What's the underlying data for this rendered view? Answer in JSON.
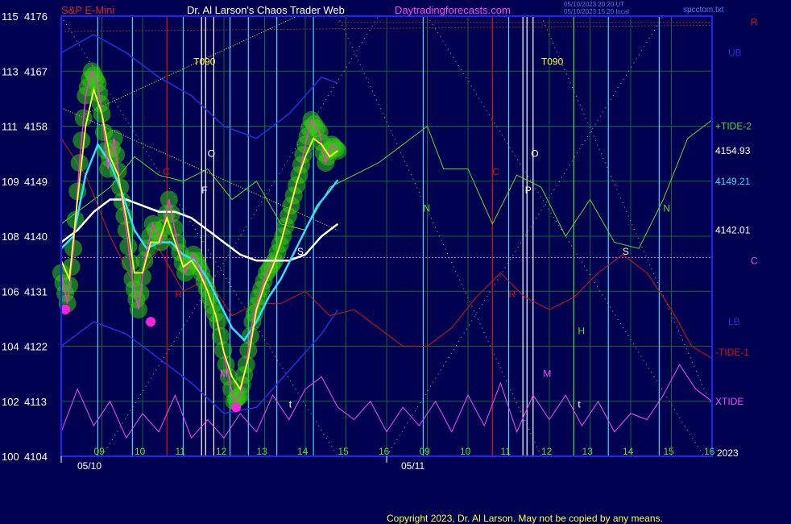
{
  "header": {
    "instrument": "S&P E-Mini",
    "site": "Dr. Al Larson's Chaos Trader Web",
    "url": "Daytradingforecasts.com",
    "timestamp_ut": "05/10/2023 20:20 UT",
    "timestamp_local": "05/10/2023 15:20 local",
    "file": "spcctom.txt"
  },
  "footer": {
    "copyright": "Copyright 2023, Dr. Al Larson. May not be copied by any means."
  },
  "colors": {
    "background": "#000050",
    "axis": "#2222ff",
    "grid": "#0a6a3a",
    "price": "#ff33cc",
    "yellow_ma": "#ffff33",
    "cyan_ma": "#33ddff",
    "white_ma": "#ffffff",
    "tide_plus": "#55dd33",
    "tide_minus": "#dd1111",
    "xtide": "#ff44ff",
    "bands": "#2233dd",
    "green_glow": "#33cc11",
    "dates": "#6666ff"
  },
  "chart_data": {
    "type": "line",
    "title": "S&P E-Mini",
    "ylim": [
      4104,
      4176
    ],
    "y_ticks": [
      {
        "left": "100",
        "price": "4104"
      },
      {
        "left": "102",
        "price": "4113"
      },
      {
        "left": "104",
        "price": "4122"
      },
      {
        "left": "106",
        "price": "4131"
      },
      {
        "left": "108",
        "price": "4140"
      },
      {
        "left": "109",
        "price": "4149"
      },
      {
        "left": "111",
        "price": "4158"
      },
      {
        "left": "113",
        "price": "4167"
      },
      {
        "left": "115",
        "price": "4176"
      }
    ],
    "x_hours": [
      "09",
      "10",
      "11",
      "12",
      "13",
      "14",
      "15",
      "16",
      "09",
      "10",
      "11",
      "12",
      "13",
      "14",
      "15",
      "16"
    ],
    "x_dates": [
      "05/10",
      "05/11"
    ],
    "year_label": "2023",
    "price_series": [
      {
        "t": 0.0,
        "p": 4134
      },
      {
        "t": 0.15,
        "p": 4129
      },
      {
        "t": 0.3,
        "p": 4138
      },
      {
        "t": 0.45,
        "p": 4152
      },
      {
        "t": 0.6,
        "p": 4163
      },
      {
        "t": 0.75,
        "p": 4167
      },
      {
        "t": 0.9,
        "p": 4165
      },
      {
        "t": 1.0,
        "p": 4160
      },
      {
        "t": 1.15,
        "p": 4151
      },
      {
        "t": 1.3,
        "p": 4156
      },
      {
        "t": 1.45,
        "p": 4148
      },
      {
        "t": 1.6,
        "p": 4141
      },
      {
        "t": 1.75,
        "p": 4133
      },
      {
        "t": 1.9,
        "p": 4128
      },
      {
        "t": 2.05,
        "p": 4136
      },
      {
        "t": 2.25,
        "p": 4142
      },
      {
        "t": 2.45,
        "p": 4139
      },
      {
        "t": 2.65,
        "p": 4146
      },
      {
        "t": 2.85,
        "p": 4139
      },
      {
        "t": 3.05,
        "p": 4134
      },
      {
        "t": 3.25,
        "p": 4137
      },
      {
        "t": 3.45,
        "p": 4134
      },
      {
        "t": 3.65,
        "p": 4130
      },
      {
        "t": 3.85,
        "p": 4126
      },
      {
        "t": 4.05,
        "p": 4119
      },
      {
        "t": 4.25,
        "p": 4113
      },
      {
        "t": 4.4,
        "p": 4114
      },
      {
        "t": 4.55,
        "p": 4119
      },
      {
        "t": 4.7,
        "p": 4126
      },
      {
        "t": 4.85,
        "p": 4130
      },
      {
        "t": 5.05,
        "p": 4134
      },
      {
        "t": 5.25,
        "p": 4136
      },
      {
        "t": 5.45,
        "p": 4140
      },
      {
        "t": 5.65,
        "p": 4145
      },
      {
        "t": 5.85,
        "p": 4150
      },
      {
        "t": 6.0,
        "p": 4155
      },
      {
        "t": 6.15,
        "p": 4159
      },
      {
        "t": 6.35,
        "p": 4157
      },
      {
        "t": 6.5,
        "p": 4152
      },
      {
        "t": 6.65,
        "p": 4155
      },
      {
        "t": 6.8,
        "p": 4154
      }
    ],
    "yellow_series": [
      {
        "t": 0.0,
        "p": 4136
      },
      {
        "t": 0.2,
        "p": 4133
      },
      {
        "t": 0.4,
        "p": 4146
      },
      {
        "t": 0.6,
        "p": 4158
      },
      {
        "t": 0.8,
        "p": 4164
      },
      {
        "t": 1.0,
        "p": 4160
      },
      {
        "t": 1.2,
        "p": 4153
      },
      {
        "t": 1.4,
        "p": 4150
      },
      {
        "t": 1.6,
        "p": 4143
      },
      {
        "t": 1.8,
        "p": 4134
      },
      {
        "t": 2.0,
        "p": 4134
      },
      {
        "t": 2.2,
        "p": 4139
      },
      {
        "t": 2.4,
        "p": 4139
      },
      {
        "t": 2.6,
        "p": 4143
      },
      {
        "t": 2.8,
        "p": 4139
      },
      {
        "t": 3.0,
        "p": 4135
      },
      {
        "t": 3.2,
        "p": 4136
      },
      {
        "t": 3.4,
        "p": 4134
      },
      {
        "t": 3.6,
        "p": 4131
      },
      {
        "t": 3.8,
        "p": 4127
      },
      {
        "t": 4.0,
        "p": 4121
      },
      {
        "t": 4.2,
        "p": 4117
      },
      {
        "t": 4.4,
        "p": 4115
      },
      {
        "t": 4.6,
        "p": 4120
      },
      {
        "t": 4.8,
        "p": 4128
      },
      {
        "t": 5.0,
        "p": 4132
      },
      {
        "t": 5.2,
        "p": 4135
      },
      {
        "t": 5.4,
        "p": 4139
      },
      {
        "t": 5.6,
        "p": 4144
      },
      {
        "t": 5.8,
        "p": 4149
      },
      {
        "t": 6.0,
        "p": 4153
      },
      {
        "t": 6.2,
        "p": 4156
      },
      {
        "t": 6.4,
        "p": 4155
      },
      {
        "t": 6.6,
        "p": 4153
      },
      {
        "t": 6.8,
        "p": 4154
      }
    ],
    "cyan_series": [
      {
        "t": 0.0,
        "p": 4138
      },
      {
        "t": 0.3,
        "p": 4140
      },
      {
        "t": 0.6,
        "p": 4150
      },
      {
        "t": 0.9,
        "p": 4155
      },
      {
        "t": 1.2,
        "p": 4152
      },
      {
        "t": 1.5,
        "p": 4147
      },
      {
        "t": 1.8,
        "p": 4141
      },
      {
        "t": 2.1,
        "p": 4138
      },
      {
        "t": 2.4,
        "p": 4139
      },
      {
        "t": 2.7,
        "p": 4139
      },
      {
        "t": 3.0,
        "p": 4137
      },
      {
        "t": 3.3,
        "p": 4136
      },
      {
        "t": 3.6,
        "p": 4133
      },
      {
        "t": 3.9,
        "p": 4129
      },
      {
        "t": 4.2,
        "p": 4125
      },
      {
        "t": 4.5,
        "p": 4123
      },
      {
        "t": 4.8,
        "p": 4126
      },
      {
        "t": 5.1,
        "p": 4130
      },
      {
        "t": 5.4,
        "p": 4133
      },
      {
        "t": 5.7,
        "p": 4137
      },
      {
        "t": 6.0,
        "p": 4141
      },
      {
        "t": 6.3,
        "p": 4145
      },
      {
        "t": 6.55,
        "p": 4147
      },
      {
        "t": 6.8,
        "p": 4149.21
      }
    ],
    "white_series": [
      {
        "t": 0.0,
        "p": 4139
      },
      {
        "t": 0.4,
        "p": 4141
      },
      {
        "t": 0.8,
        "p": 4144
      },
      {
        "t": 1.2,
        "p": 4146
      },
      {
        "t": 1.6,
        "p": 4146
      },
      {
        "t": 2.0,
        "p": 4145
      },
      {
        "t": 2.4,
        "p": 4144
      },
      {
        "t": 2.8,
        "p": 4144
      },
      {
        "t": 3.2,
        "p": 4143
      },
      {
        "t": 3.6,
        "p": 4141
      },
      {
        "t": 4.0,
        "p": 4139
      },
      {
        "t": 4.4,
        "p": 4137
      },
      {
        "t": 4.8,
        "p": 4136
      },
      {
        "t": 5.2,
        "p": 4136
      },
      {
        "t": 5.6,
        "p": 4136
      },
      {
        "t": 6.0,
        "p": 4137
      },
      {
        "t": 6.4,
        "p": 4140
      },
      {
        "t": 6.8,
        "p": 4142.01
      }
    ],
    "tide_plus_series": [
      {
        "t": 0.0,
        "p": 4142
      },
      {
        "t": 0.6,
        "p": 4145
      },
      {
        "t": 1.2,
        "p": 4148
      },
      {
        "t": 1.8,
        "p": 4153
      },
      {
        "t": 2.4,
        "p": 4150
      },
      {
        "t": 3.0,
        "p": 4149
      },
      {
        "t": 3.6,
        "p": 4151
      },
      {
        "t": 4.2,
        "p": 4146
      },
      {
        "t": 4.8,
        "p": 4149
      },
      {
        "t": 5.4,
        "p": 4142
      },
      {
        "t": 6.0,
        "p": 4141
      },
      {
        "t": 6.6,
        "p": 4148
      },
      {
        "t": 7.2,
        "p": 4150
      },
      {
        "t": 7.8,
        "p": 4152
      },
      {
        "t": 8.4,
        "p": 4155
      },
      {
        "t": 9.0,
        "p": 4158
      },
      {
        "t": 9.4,
        "p": 4151
      },
      {
        "t": 10.0,
        "p": 4151
      },
      {
        "t": 10.6,
        "p": 4142
      },
      {
        "t": 11.2,
        "p": 4150
      },
      {
        "t": 11.8,
        "p": 4148
      },
      {
        "t": 12.4,
        "p": 4140
      },
      {
        "t": 13.0,
        "p": 4146
      },
      {
        "t": 13.6,
        "p": 4139
      },
      {
        "t": 14.2,
        "p": 4138
      },
      {
        "t": 14.8,
        "p": 4146
      },
      {
        "t": 15.4,
        "p": 4156
      },
      {
        "t": 15.8,
        "p": 4158
      },
      {
        "t": 16.0,
        "p": 4159
      }
    ],
    "tide_minus_series": [
      {
        "t": 0.0,
        "p": 4156
      },
      {
        "t": 0.6,
        "p": 4150
      },
      {
        "t": 1.2,
        "p": 4140
      },
      {
        "t": 1.8,
        "p": 4132
      },
      {
        "t": 2.4,
        "p": 4138
      },
      {
        "t": 3.0,
        "p": 4131
      },
      {
        "t": 3.6,
        "p": 4133
      },
      {
        "t": 4.2,
        "p": 4127
      },
      {
        "t": 4.8,
        "p": 4129
      },
      {
        "t": 5.4,
        "p": 4129
      },
      {
        "t": 6.0,
        "p": 4131
      },
      {
        "t": 6.6,
        "p": 4127
      },
      {
        "t": 7.2,
        "p": 4128
      },
      {
        "t": 7.8,
        "p": 4125
      },
      {
        "t": 8.4,
        "p": 4122
      },
      {
        "t": 9.0,
        "p": 4122
      },
      {
        "t": 9.6,
        "p": 4125
      },
      {
        "t": 10.2,
        "p": 4130
      },
      {
        "t": 10.8,
        "p": 4134
      },
      {
        "t": 11.4,
        "p": 4130
      },
      {
        "t": 12.0,
        "p": 4128
      },
      {
        "t": 12.6,
        "p": 4130
      },
      {
        "t": 13.2,
        "p": 4134
      },
      {
        "t": 13.8,
        "p": 4137
      },
      {
        "t": 14.4,
        "p": 4134
      },
      {
        "t": 15.0,
        "p": 4128
      },
      {
        "t": 15.5,
        "p": 4122
      },
      {
        "t": 16.0,
        "p": 4120
      }
    ],
    "xtide_series": [
      {
        "t": 0.0,
        "p": 4108
      },
      {
        "t": 0.4,
        "p": 4115
      },
      {
        "t": 0.8,
        "p": 4109
      },
      {
        "t": 1.2,
        "p": 4113
      },
      {
        "t": 1.6,
        "p": 4107
      },
      {
        "t": 2.0,
        "p": 4111
      },
      {
        "t": 2.4,
        "p": 4108
      },
      {
        "t": 2.8,
        "p": 4114
      },
      {
        "t": 3.2,
        "p": 4107
      },
      {
        "t": 3.6,
        "p": 4110
      },
      {
        "t": 4.0,
        "p": 4107
      },
      {
        "t": 4.4,
        "p": 4111
      },
      {
        "t": 4.8,
        "p": 4108
      },
      {
        "t": 5.2,
        "p": 4114
      },
      {
        "t": 5.6,
        "p": 4110
      },
      {
        "t": 6.0,
        "p": 4115
      },
      {
        "t": 6.4,
        "p": 4117
      },
      {
        "t": 6.8,
        "p": 4112
      },
      {
        "t": 7.2,
        "p": 4110
      },
      {
        "t": 7.6,
        "p": 4113
      },
      {
        "t": 8.0,
        "p": 4108
      },
      {
        "t": 8.4,
        "p": 4112
      },
      {
        "t": 8.8,
        "p": 4109
      },
      {
        "t": 9.2,
        "p": 4113
      },
      {
        "t": 9.6,
        "p": 4108
      },
      {
        "t": 10.0,
        "p": 4114
      },
      {
        "t": 10.4,
        "p": 4109
      },
      {
        "t": 10.8,
        "p": 4116
      },
      {
        "t": 11.2,
        "p": 4108
      },
      {
        "t": 11.6,
        "p": 4114
      },
      {
        "t": 12.0,
        "p": 4110
      },
      {
        "t": 12.4,
        "p": 4114
      },
      {
        "t": 12.8,
        "p": 4109
      },
      {
        "t": 13.2,
        "p": 4113
      },
      {
        "t": 13.6,
        "p": 4108
      },
      {
        "t": 14.0,
        "p": 4111
      },
      {
        "t": 14.4,
        "p": 4110
      },
      {
        "t": 14.8,
        "p": 4114
      },
      {
        "t": 15.2,
        "p": 4119
      },
      {
        "t": 15.6,
        "p": 4115
      },
      {
        "t": 16.0,
        "p": 4113
      }
    ],
    "upper_band_series": [
      {
        "t": 0.0,
        "p": 4170
      },
      {
        "t": 0.8,
        "p": 4173
      },
      {
        "t": 1.6,
        "p": 4170
      },
      {
        "t": 2.4,
        "p": 4166
      },
      {
        "t": 3.2,
        "p": 4163
      },
      {
        "t": 4.0,
        "p": 4158
      },
      {
        "t": 4.8,
        "p": 4156
      },
      {
        "t": 5.6,
        "p": 4160
      },
      {
        "t": 6.4,
        "p": 4166
      },
      {
        "t": 6.8,
        "p": 4165
      }
    ],
    "lower_band_series": [
      {
        "t": 0.0,
        "p": 4122
      },
      {
        "t": 0.8,
        "p": 4126
      },
      {
        "t": 1.6,
        "p": 4124
      },
      {
        "t": 2.4,
        "p": 4120
      },
      {
        "t": 3.2,
        "p": 4116
      },
      {
        "t": 4.0,
        "p": 4111
      },
      {
        "t": 4.8,
        "p": 4112
      },
      {
        "t": 5.6,
        "p": 4118
      },
      {
        "t": 6.4,
        "p": 4124
      },
      {
        "t": 6.8,
        "p": 4128
      }
    ],
    "markers_low": [
      {
        "t": 0.1,
        "p": 4128
      },
      {
        "t": 2.2,
        "p": 4126
      },
      {
        "t": 4.3,
        "p": 4112
      }
    ],
    "dotted_level": 4136.5,
    "vertical_lines": [
      {
        "t": 0.9,
        "c": "#33ddff"
      },
      {
        "t": 1.75,
        "c": "#33ddff"
      },
      {
        "t": 2.6,
        "c": "#dd1111"
      },
      {
        "t": 3.0,
        "c": "#33ddff"
      },
      {
        "t": 3.45,
        "c": "#ffffff"
      },
      {
        "t": 3.55,
        "c": "#ffffff"
      },
      {
        "t": 3.75,
        "c": "#ffffff"
      },
      {
        "t": 4.15,
        "c": "#33ddff"
      },
      {
        "t": 4.6,
        "c": "#33ddff"
      },
      {
        "t": 5.3,
        "c": "#33ddff"
      },
      {
        "t": 6.2,
        "c": "#33ddff"
      },
      {
        "t": 8.9,
        "c": "#33ddff"
      },
      {
        "t": 10.6,
        "c": "#dd1111"
      },
      {
        "t": 11.0,
        "c": "#33ddff"
      },
      {
        "t": 11.35,
        "c": "#ffffff"
      },
      {
        "t": 11.45,
        "c": "#ffffff"
      },
      {
        "t": 11.6,
        "c": "#ffffff"
      },
      {
        "t": 12.6,
        "c": "#55dd33"
      },
      {
        "t": 13.45,
        "c": "#33ddff"
      },
      {
        "t": 14.7,
        "c": "#33ddff"
      }
    ],
    "annotations": [
      {
        "text": "T090",
        "t": 3.25,
        "p": 4168,
        "c": "#ffff33"
      },
      {
        "text": "T090",
        "t": 11.8,
        "p": 4168,
        "c": "#ffff33"
      },
      {
        "text": "O",
        "t": 3.6,
        "p": 4153,
        "c": "#ffffff"
      },
      {
        "text": "O",
        "t": 11.55,
        "p": 4153,
        "c": "#ffffff"
      },
      {
        "text": "C",
        "t": 2.5,
        "p": 4150,
        "c": "#dd1111"
      },
      {
        "text": "C",
        "t": 10.6,
        "p": 4150,
        "c": "#dd1111"
      },
      {
        "text": "F",
        "t": 3.45,
        "p": 4147,
        "c": "#ffffff"
      },
      {
        "text": "P",
        "t": 11.4,
        "p": 4147,
        "c": "#ffffff"
      },
      {
        "text": "N",
        "t": 8.9,
        "p": 4144,
        "c": "#55dd33"
      },
      {
        "text": "N",
        "t": 14.8,
        "p": 4144,
        "c": "#55dd33"
      },
      {
        "text": "R",
        "t": 2.8,
        "p": 4130,
        "c": "#dd1111"
      },
      {
        "text": "R",
        "t": 11.0,
        "p": 4130,
        "c": "#dd1111"
      },
      {
        "text": "S",
        "t": 5.8,
        "p": 4137,
        "c": "#ffffff"
      },
      {
        "text": "S",
        "t": 13.8,
        "p": 4137,
        "c": "#ffffff"
      },
      {
        "text": "H",
        "t": 12.7,
        "p": 4124,
        "c": "#55dd33"
      },
      {
        "text": "M",
        "t": 3.9,
        "p": 4117,
        "c": "#ff44ff"
      },
      {
        "text": "M",
        "t": 11.85,
        "p": 4117,
        "c": "#ff44ff"
      },
      {
        "text": "t",
        "t": 5.6,
        "p": 4112,
        "c": "#ffffff"
      },
      {
        "text": "t",
        "t": 12.7,
        "p": 4112,
        "c": "#ffffff"
      }
    ],
    "right_labels": [
      {
        "text": "R",
        "p": 4175,
        "c": "#dd1111"
      },
      {
        "text": "UB",
        "p": 4170,
        "c": "#2233dd"
      },
      {
        "text": "+TIDE-2",
        "p": 4158,
        "c": "#55dd33"
      },
      {
        "text": "4154.93",
        "p": 4154,
        "c": "#ffffff"
      },
      {
        "text": "4149.21",
        "p": 4149,
        "c": "#33ddff"
      },
      {
        "text": "4142.01",
        "p": 4141,
        "c": "#ffffff"
      },
      {
        "text": "C",
        "p": 4136,
        "c": "#ff44ff"
      },
      {
        "text": "LB",
        "p": 4126,
        "c": "#2233dd"
      },
      {
        "text": "-TIDE-1",
        "p": 4121,
        "c": "#dd1111"
      },
      {
        "text": "XTIDE",
        "p": 4113,
        "c": "#ff44ff"
      }
    ]
  }
}
